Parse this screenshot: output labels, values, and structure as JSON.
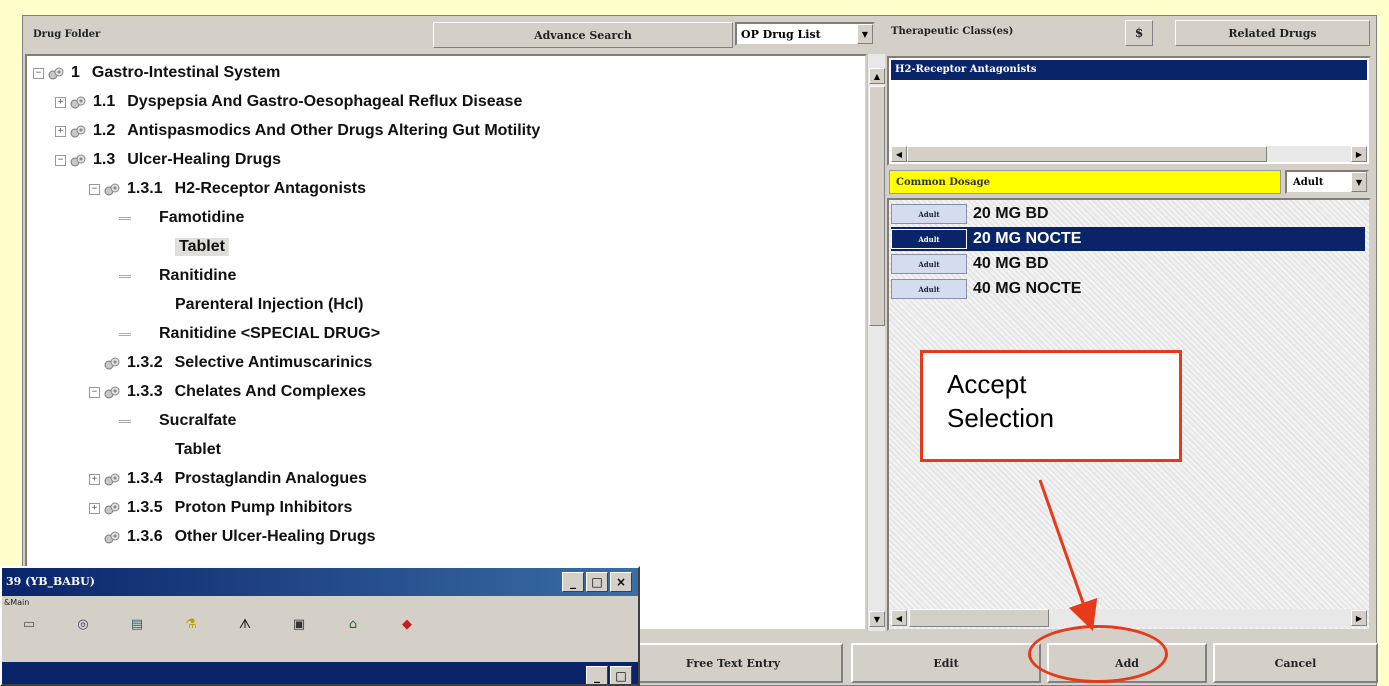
{
  "left_panel": {
    "header": "Drug Folder",
    "advance_search": "Advance Search",
    "list_select": "OP Drug List"
  },
  "tree": [
    {
      "expander": "−",
      "num": "1",
      "label": "Gastro-Intestinal System"
    },
    {
      "expander": "+",
      "num": "1.1",
      "label": "Dyspepsia And Gastro-Oesophageal Reflux Disease"
    },
    {
      "expander": "+",
      "num": "1.2",
      "label": "Antispasmodics And Other Drugs Altering Gut Motility"
    },
    {
      "expander": "−",
      "num": "1.3",
      "label": "Ulcer-Healing Drugs"
    },
    {
      "expander": "−",
      "num": "1.3.1",
      "label": "H2-Receptor Antagonists"
    },
    {
      "label": "Famotidine"
    },
    {
      "label": "Tablet"
    },
    {
      "label": "Ranitidine"
    },
    {
      "label": "Parenteral Injection (Hcl)"
    },
    {
      "label": "Ranitidine <SPECIAL DRUG>"
    },
    {
      "num": "1.3.2",
      "label": "Selective Antimuscarinics"
    },
    {
      "expander": "−",
      "num": "1.3.3",
      "label": "Chelates And Complexes"
    },
    {
      "label": "Sucralfate"
    },
    {
      "label": "Tablet"
    },
    {
      "expander": "+",
      "num": "1.3.4",
      "label": "Prostaglandin Analogues"
    },
    {
      "expander": "+",
      "num": "1.3.5",
      "label": "Proton Pump Inhibitors"
    },
    {
      "num": "1.3.6",
      "label": "Other Ulcer-Healing Drugs"
    }
  ],
  "right_panel": {
    "header": "Therapeutic Class(es)",
    "dollar_button": "$",
    "related_button": "Related Drugs",
    "selected_class": "H2-Receptor Antagonists",
    "dosage_label": "Common Dosage",
    "age_select": "Adult",
    "dosages": [
      {
        "tag": "Adult",
        "text": "20 MG BD"
      },
      {
        "tag": "Adult",
        "text": "20 MG NOCTE"
      },
      {
        "tag": "Adult",
        "text": "40 MG BD"
      },
      {
        "tag": "Adult",
        "text": "40 MG NOCTE"
      }
    ],
    "selected_dosage_index": 1
  },
  "callout": {
    "line1": "Accept",
    "line2": "Selection"
  },
  "bottom_buttons": {
    "free_text": "Free Text Entry",
    "edit": "Edit",
    "add": "Add",
    "cancel": "Cancel"
  },
  "popup_window": {
    "title": "39 (YB_BABU)",
    "menu": "&Main",
    "controls": [
      "_",
      "□",
      "×"
    ]
  },
  "colors": {
    "page_background": "#ffffcc",
    "selection_blue": "#0a246a",
    "dosage_header_yellow": "#ffff00",
    "annotation_red": "#e63a1a"
  }
}
